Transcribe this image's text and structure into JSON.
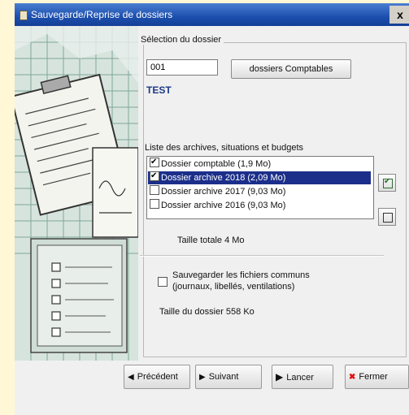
{
  "window": {
    "title": "Sauvegarde/Reprise de dossiers",
    "close_label": "x"
  },
  "selection": {
    "legend": "Sélection du dossier",
    "dossier_value": "001",
    "comptables_button": "dossiers Comptables",
    "dossier_name": "TEST"
  },
  "archives": {
    "label": "Liste des archives, situations et budgets",
    "items": [
      {
        "label": "Dossier comptable (1,9 Mo)",
        "checked": true,
        "selected": false
      },
      {
        "label": "Dossier archive 2018 (2,09 Mo)",
        "checked": true,
        "selected": true
      },
      {
        "label": "Dossier archive 2017 (9,03 Mo)",
        "checked": false,
        "selected": false
      },
      {
        "label": "Dossier archive 2016 (9,03 Mo)",
        "checked": false,
        "selected": false
      }
    ],
    "taille_totale": "Taille totale 4 Mo"
  },
  "communs": {
    "label_line1": "Sauvegarder les fichiers communs",
    "label_line2": "(journaux, libellés, ventilations)",
    "checked": false
  },
  "taille_dossier": "Taille du dossier 558 Ko",
  "buttons": {
    "precedent": "Précédent",
    "suivant": "Suivant",
    "lancer": "Lancer",
    "fermer": "Fermer"
  }
}
